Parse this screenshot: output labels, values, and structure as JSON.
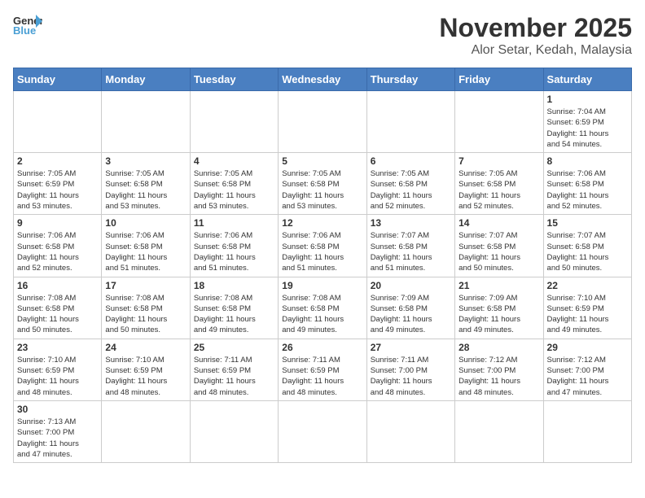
{
  "header": {
    "logo_general": "General",
    "logo_blue": "Blue",
    "month": "November 2025",
    "location": "Alor Setar, Kedah, Malaysia"
  },
  "weekdays": [
    "Sunday",
    "Monday",
    "Tuesday",
    "Wednesday",
    "Thursday",
    "Friday",
    "Saturday"
  ],
  "weeks": [
    [
      {
        "day": "",
        "info": ""
      },
      {
        "day": "",
        "info": ""
      },
      {
        "day": "",
        "info": ""
      },
      {
        "day": "",
        "info": ""
      },
      {
        "day": "",
        "info": ""
      },
      {
        "day": "",
        "info": ""
      },
      {
        "day": "1",
        "info": "Sunrise: 7:04 AM\nSunset: 6:59 PM\nDaylight: 11 hours\nand 54 minutes."
      }
    ],
    [
      {
        "day": "2",
        "info": "Sunrise: 7:05 AM\nSunset: 6:59 PM\nDaylight: 11 hours\nand 53 minutes."
      },
      {
        "day": "3",
        "info": "Sunrise: 7:05 AM\nSunset: 6:58 PM\nDaylight: 11 hours\nand 53 minutes."
      },
      {
        "day": "4",
        "info": "Sunrise: 7:05 AM\nSunset: 6:58 PM\nDaylight: 11 hours\nand 53 minutes."
      },
      {
        "day": "5",
        "info": "Sunrise: 7:05 AM\nSunset: 6:58 PM\nDaylight: 11 hours\nand 53 minutes."
      },
      {
        "day": "6",
        "info": "Sunrise: 7:05 AM\nSunset: 6:58 PM\nDaylight: 11 hours\nand 52 minutes."
      },
      {
        "day": "7",
        "info": "Sunrise: 7:05 AM\nSunset: 6:58 PM\nDaylight: 11 hours\nand 52 minutes."
      },
      {
        "day": "8",
        "info": "Sunrise: 7:06 AM\nSunset: 6:58 PM\nDaylight: 11 hours\nand 52 minutes."
      }
    ],
    [
      {
        "day": "9",
        "info": "Sunrise: 7:06 AM\nSunset: 6:58 PM\nDaylight: 11 hours\nand 52 minutes."
      },
      {
        "day": "10",
        "info": "Sunrise: 7:06 AM\nSunset: 6:58 PM\nDaylight: 11 hours\nand 51 minutes."
      },
      {
        "day": "11",
        "info": "Sunrise: 7:06 AM\nSunset: 6:58 PM\nDaylight: 11 hours\nand 51 minutes."
      },
      {
        "day": "12",
        "info": "Sunrise: 7:06 AM\nSunset: 6:58 PM\nDaylight: 11 hours\nand 51 minutes."
      },
      {
        "day": "13",
        "info": "Sunrise: 7:07 AM\nSunset: 6:58 PM\nDaylight: 11 hours\nand 51 minutes."
      },
      {
        "day": "14",
        "info": "Sunrise: 7:07 AM\nSunset: 6:58 PM\nDaylight: 11 hours\nand 50 minutes."
      },
      {
        "day": "15",
        "info": "Sunrise: 7:07 AM\nSunset: 6:58 PM\nDaylight: 11 hours\nand 50 minutes."
      }
    ],
    [
      {
        "day": "16",
        "info": "Sunrise: 7:08 AM\nSunset: 6:58 PM\nDaylight: 11 hours\nand 50 minutes."
      },
      {
        "day": "17",
        "info": "Sunrise: 7:08 AM\nSunset: 6:58 PM\nDaylight: 11 hours\nand 50 minutes."
      },
      {
        "day": "18",
        "info": "Sunrise: 7:08 AM\nSunset: 6:58 PM\nDaylight: 11 hours\nand 49 minutes."
      },
      {
        "day": "19",
        "info": "Sunrise: 7:08 AM\nSunset: 6:58 PM\nDaylight: 11 hours\nand 49 minutes."
      },
      {
        "day": "20",
        "info": "Sunrise: 7:09 AM\nSunset: 6:58 PM\nDaylight: 11 hours\nand 49 minutes."
      },
      {
        "day": "21",
        "info": "Sunrise: 7:09 AM\nSunset: 6:58 PM\nDaylight: 11 hours\nand 49 minutes."
      },
      {
        "day": "22",
        "info": "Sunrise: 7:10 AM\nSunset: 6:59 PM\nDaylight: 11 hours\nand 49 minutes."
      }
    ],
    [
      {
        "day": "23",
        "info": "Sunrise: 7:10 AM\nSunset: 6:59 PM\nDaylight: 11 hours\nand 48 minutes."
      },
      {
        "day": "24",
        "info": "Sunrise: 7:10 AM\nSunset: 6:59 PM\nDaylight: 11 hours\nand 48 minutes."
      },
      {
        "day": "25",
        "info": "Sunrise: 7:11 AM\nSunset: 6:59 PM\nDaylight: 11 hours\nand 48 minutes."
      },
      {
        "day": "26",
        "info": "Sunrise: 7:11 AM\nSunset: 6:59 PM\nDaylight: 11 hours\nand 48 minutes."
      },
      {
        "day": "27",
        "info": "Sunrise: 7:11 AM\nSunset: 7:00 PM\nDaylight: 11 hours\nand 48 minutes."
      },
      {
        "day": "28",
        "info": "Sunrise: 7:12 AM\nSunset: 7:00 PM\nDaylight: 11 hours\nand 48 minutes."
      },
      {
        "day": "29",
        "info": "Sunrise: 7:12 AM\nSunset: 7:00 PM\nDaylight: 11 hours\nand 47 minutes."
      }
    ],
    [
      {
        "day": "30",
        "info": "Sunrise: 7:13 AM\nSunset: 7:00 PM\nDaylight: 11 hours\nand 47 minutes."
      },
      {
        "day": "",
        "info": ""
      },
      {
        "day": "",
        "info": ""
      },
      {
        "day": "",
        "info": ""
      },
      {
        "day": "",
        "info": ""
      },
      {
        "day": "",
        "info": ""
      },
      {
        "day": "",
        "info": ""
      }
    ]
  ]
}
